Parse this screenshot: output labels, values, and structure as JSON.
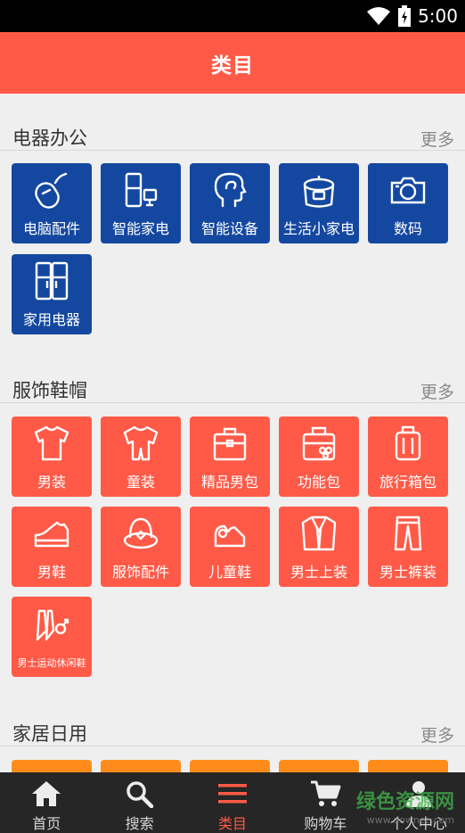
{
  "status_bar": {
    "time": "5:00"
  },
  "header": {
    "title": "类目"
  },
  "sections": [
    {
      "name": "电器办公",
      "more": "更多",
      "items": [
        {
          "label": "电脑配件",
          "icon": "mouse-icon"
        },
        {
          "label": "智能家电",
          "icon": "smart-appliance-icon"
        },
        {
          "label": "智能设备",
          "icon": "smart-head-icon"
        },
        {
          "label": "生活小家电",
          "icon": "rice-cooker-icon"
        },
        {
          "label": "数码",
          "icon": "camera-icon"
        },
        {
          "label": "家用电器",
          "icon": "fridge-icon"
        }
      ]
    },
    {
      "name": "服饰鞋帽",
      "more": "更多",
      "items": [
        {
          "label": "男装",
          "icon": "tshirt-icon"
        },
        {
          "label": "童装",
          "icon": "kids-clothes-icon"
        },
        {
          "label": "精品男包",
          "icon": "briefcase-icon"
        },
        {
          "label": "功能包",
          "icon": "function-bag-icon"
        },
        {
          "label": "旅行箱包",
          "icon": "luggage-icon"
        },
        {
          "label": "男鞋",
          "icon": "mens-shoe-icon"
        },
        {
          "label": "服饰配件",
          "icon": "hat-icon"
        },
        {
          "label": "儿童鞋",
          "icon": "kids-shoe-icon"
        },
        {
          "label": "男士上装",
          "icon": "suit-icon"
        },
        {
          "label": "男士裤装",
          "icon": "trousers-icon"
        },
        {
          "label": "男士运动休闲鞋",
          "icon": "sport-shoe-icon"
        }
      ]
    },
    {
      "name": "家居日用",
      "more": "更多",
      "items": []
    }
  ],
  "tabs": [
    {
      "label": "首页",
      "icon": "home-icon"
    },
    {
      "label": "搜索",
      "icon": "search-icon"
    },
    {
      "label": "类目",
      "icon": "menu-icon",
      "active": true
    },
    {
      "label": "购物车",
      "icon": "cart-icon"
    },
    {
      "label": "个人中心",
      "icon": "person-icon"
    }
  ],
  "watermark": {
    "text": "绿色资源网",
    "url": "www.downcc.com"
  },
  "colors": {
    "accent": "#ff5a47",
    "blue_tile": "#1448a0",
    "tabbar": "#262626"
  }
}
